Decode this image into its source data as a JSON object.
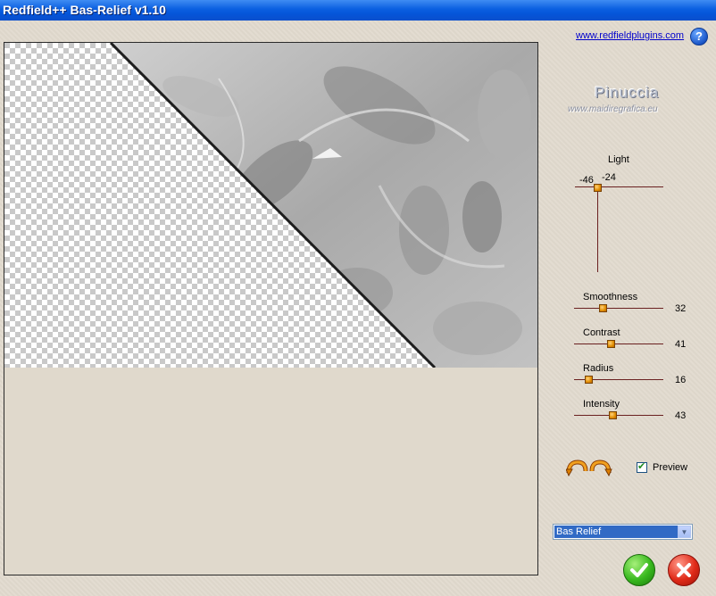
{
  "window": {
    "title": "Redfield++ Bas-Relief v1.10"
  },
  "header": {
    "link_text": "www.redfieldplugins.com",
    "help_glyph": "?"
  },
  "watermark": {
    "name": "Pinuccia",
    "url": "www.maidiregrafica.eu"
  },
  "light": {
    "label": "Light",
    "x_value": "-46",
    "y_value": "-24"
  },
  "sliders": [
    {
      "label": "Smoothness",
      "value": "32",
      "level": 0.32
    },
    {
      "label": "Contrast",
      "value": "41",
      "level": 0.41
    },
    {
      "label": "Radius",
      "value": "16",
      "level": 0.16
    },
    {
      "label": "Intensity",
      "value": "43",
      "level": 0.43
    }
  ],
  "preview": {
    "label": "Preview",
    "checked": true
  },
  "preset": {
    "selected": "Bas Relief"
  },
  "icons": {
    "help": "help-icon",
    "undo": "undo-arrow-icon",
    "redo": "redo-arrow-icon",
    "ok": "check-icon",
    "cancel": "close-icon",
    "dropdown": "chevron-down-icon"
  },
  "colors": {
    "title_bar": "#0554d8",
    "background": "#e1dace",
    "slider_track": "#6a2020",
    "slider_thumb": "#e08c00",
    "select_highlight": "#316ac5",
    "ok": "#38b81e",
    "cancel": "#e02a18"
  }
}
